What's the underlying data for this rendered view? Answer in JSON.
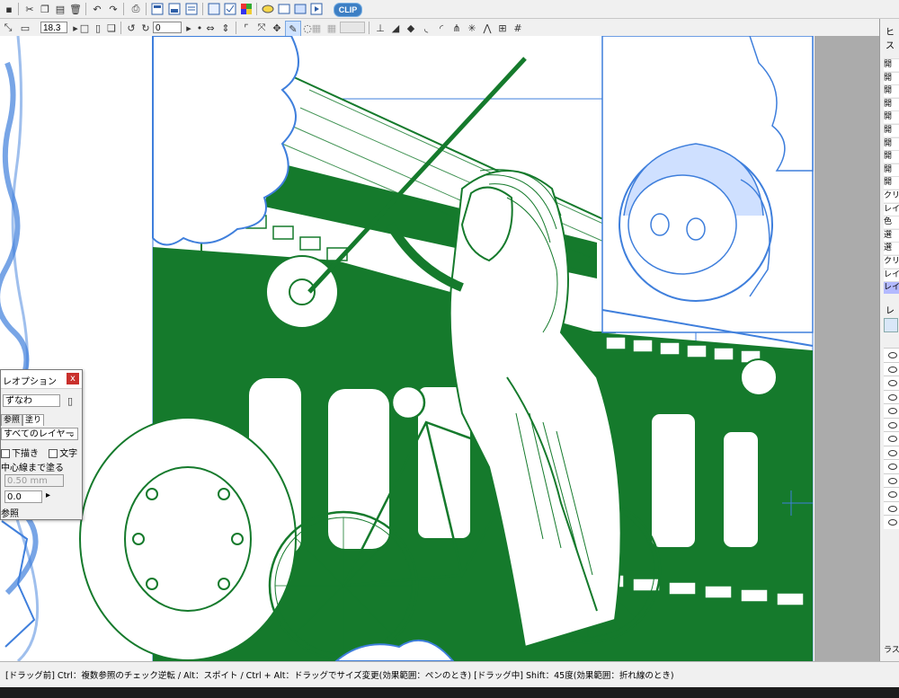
{
  "toolbar": {
    "brush_size": "18.3",
    "rotation_value": "0",
    "cls_badge": "CLIP"
  },
  "option_panel": {
    "title": "レオプション",
    "close_label": "x",
    "tool_name": "ずなわ",
    "tabs": [
      "参照",
      "塗り"
    ],
    "layer_select": "すべてのレイヤー",
    "check_draft": "下描き",
    "check_text": "文字",
    "fill_center": "中心線まで塗る",
    "width_value": "0.50 mm",
    "value_field": "0.0",
    "ref_label": "参照"
  },
  "right_panel": {
    "header": "ヒス",
    "history": [
      "開",
      "開",
      "開",
      "開",
      "開",
      "開",
      "開",
      "開",
      "開",
      "開",
      "クリ",
      "レイ",
      "色",
      "選",
      "選",
      "クリ",
      "レイ",
      "レイ"
    ],
    "layer_header": "レイ",
    "bottom_label": "ラス"
  },
  "status": {
    "text": "[ドラッグ前] Ctrl：複数参照のチェック逆転 / Alt：スポイト / Ctrl + Alt：ドラッグでサイズ変更(効果範囲：ペンのとき)  [ドラッグ中] Shift：45度(効果範囲：折れ線のとき)"
  },
  "colors": {
    "ink_green": "#157a2c",
    "ink_blue": "#3f7fdc",
    "history_selected": "#b3b9ff",
    "close_red": "#c9302c"
  }
}
